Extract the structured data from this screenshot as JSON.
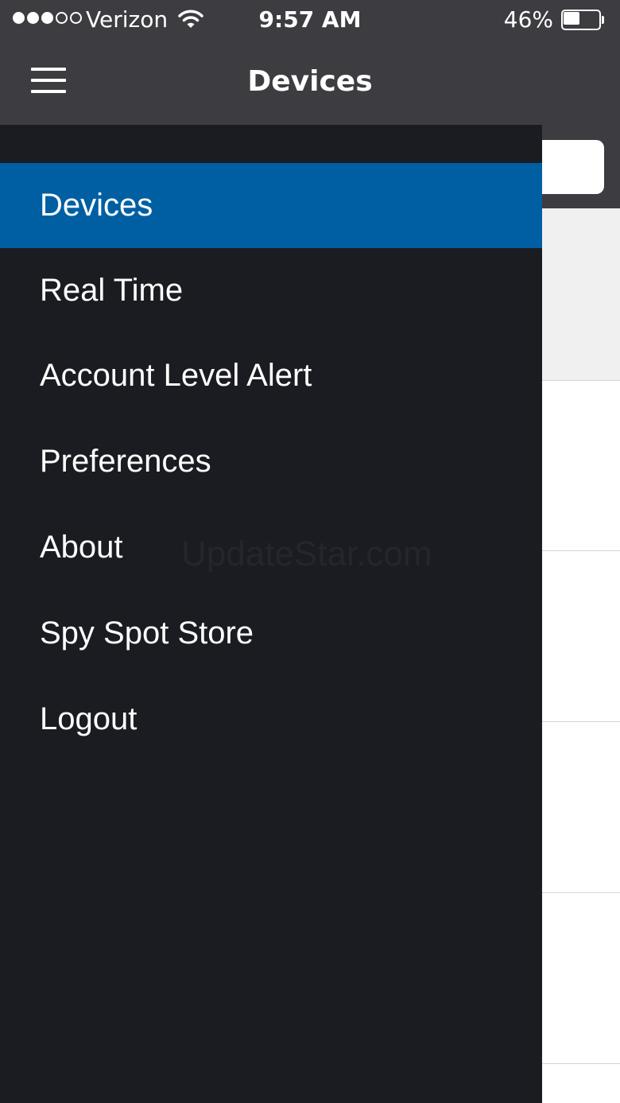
{
  "status_bar": {
    "carrier": "Verizon",
    "time": "9:57 AM",
    "battery_percent": "46%",
    "battery_level": 0.46,
    "signal_bars_filled": 3,
    "signal_bars_total": 5,
    "wifi_icon": "wifi-icon"
  },
  "nav": {
    "title": "Devices",
    "menu_icon": "hamburger-menu-icon"
  },
  "drawer": {
    "items": [
      {
        "label": "Devices",
        "active": true
      },
      {
        "label": "Real Time",
        "active": false
      },
      {
        "label": "Account Level Alert",
        "active": false
      },
      {
        "label": "Preferences",
        "active": false
      },
      {
        "label": "About",
        "active": false
      },
      {
        "label": "Spy Spot Store",
        "active": false
      },
      {
        "label": "Logout",
        "active": false
      }
    ],
    "watermark": "UpdateStar.com"
  },
  "colors": {
    "nav_background": "#3d3c41",
    "drawer_background": "#1b1c22",
    "active_item": "#005fa3",
    "text": "#ffffff"
  }
}
